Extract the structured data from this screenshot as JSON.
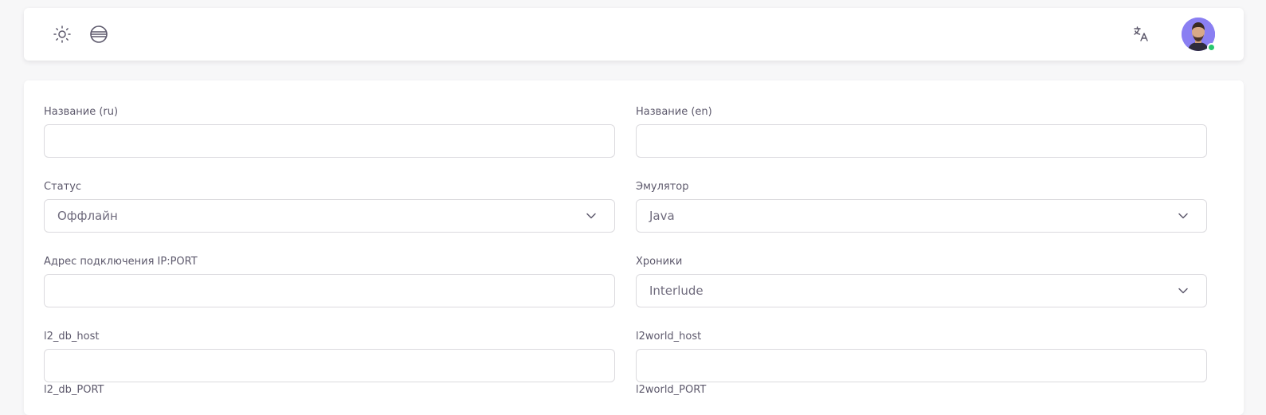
{
  "topbar": {
    "icons": [
      "sun-icon",
      "theme-stripes-icon",
      "translate-icon"
    ],
    "translate_glyph": "文A"
  },
  "form": {
    "name_ru": {
      "label": "Название (ru)",
      "value": ""
    },
    "name_en": {
      "label": "Название (en)",
      "value": ""
    },
    "status": {
      "label": "Статус",
      "selected": "Оффлайн"
    },
    "emulator": {
      "label": "Эмулятор",
      "selected": "Java"
    },
    "address": {
      "label": "Адрес подключения IP:PORT",
      "value": ""
    },
    "chronicles": {
      "label": "Хроники",
      "selected": "Interlude"
    },
    "db_host": {
      "label": "l2_db_host",
      "value": ""
    },
    "world_host": {
      "label": "l2world_host",
      "value": ""
    },
    "db_port": {
      "label": "l2_db_PORT"
    },
    "world_port": {
      "label": "l2world_PORT"
    }
  },
  "colors": {
    "accent": "#7367f0",
    "online": "#28c76f",
    "border": "#dbdade",
    "text": "#5d596c"
  }
}
